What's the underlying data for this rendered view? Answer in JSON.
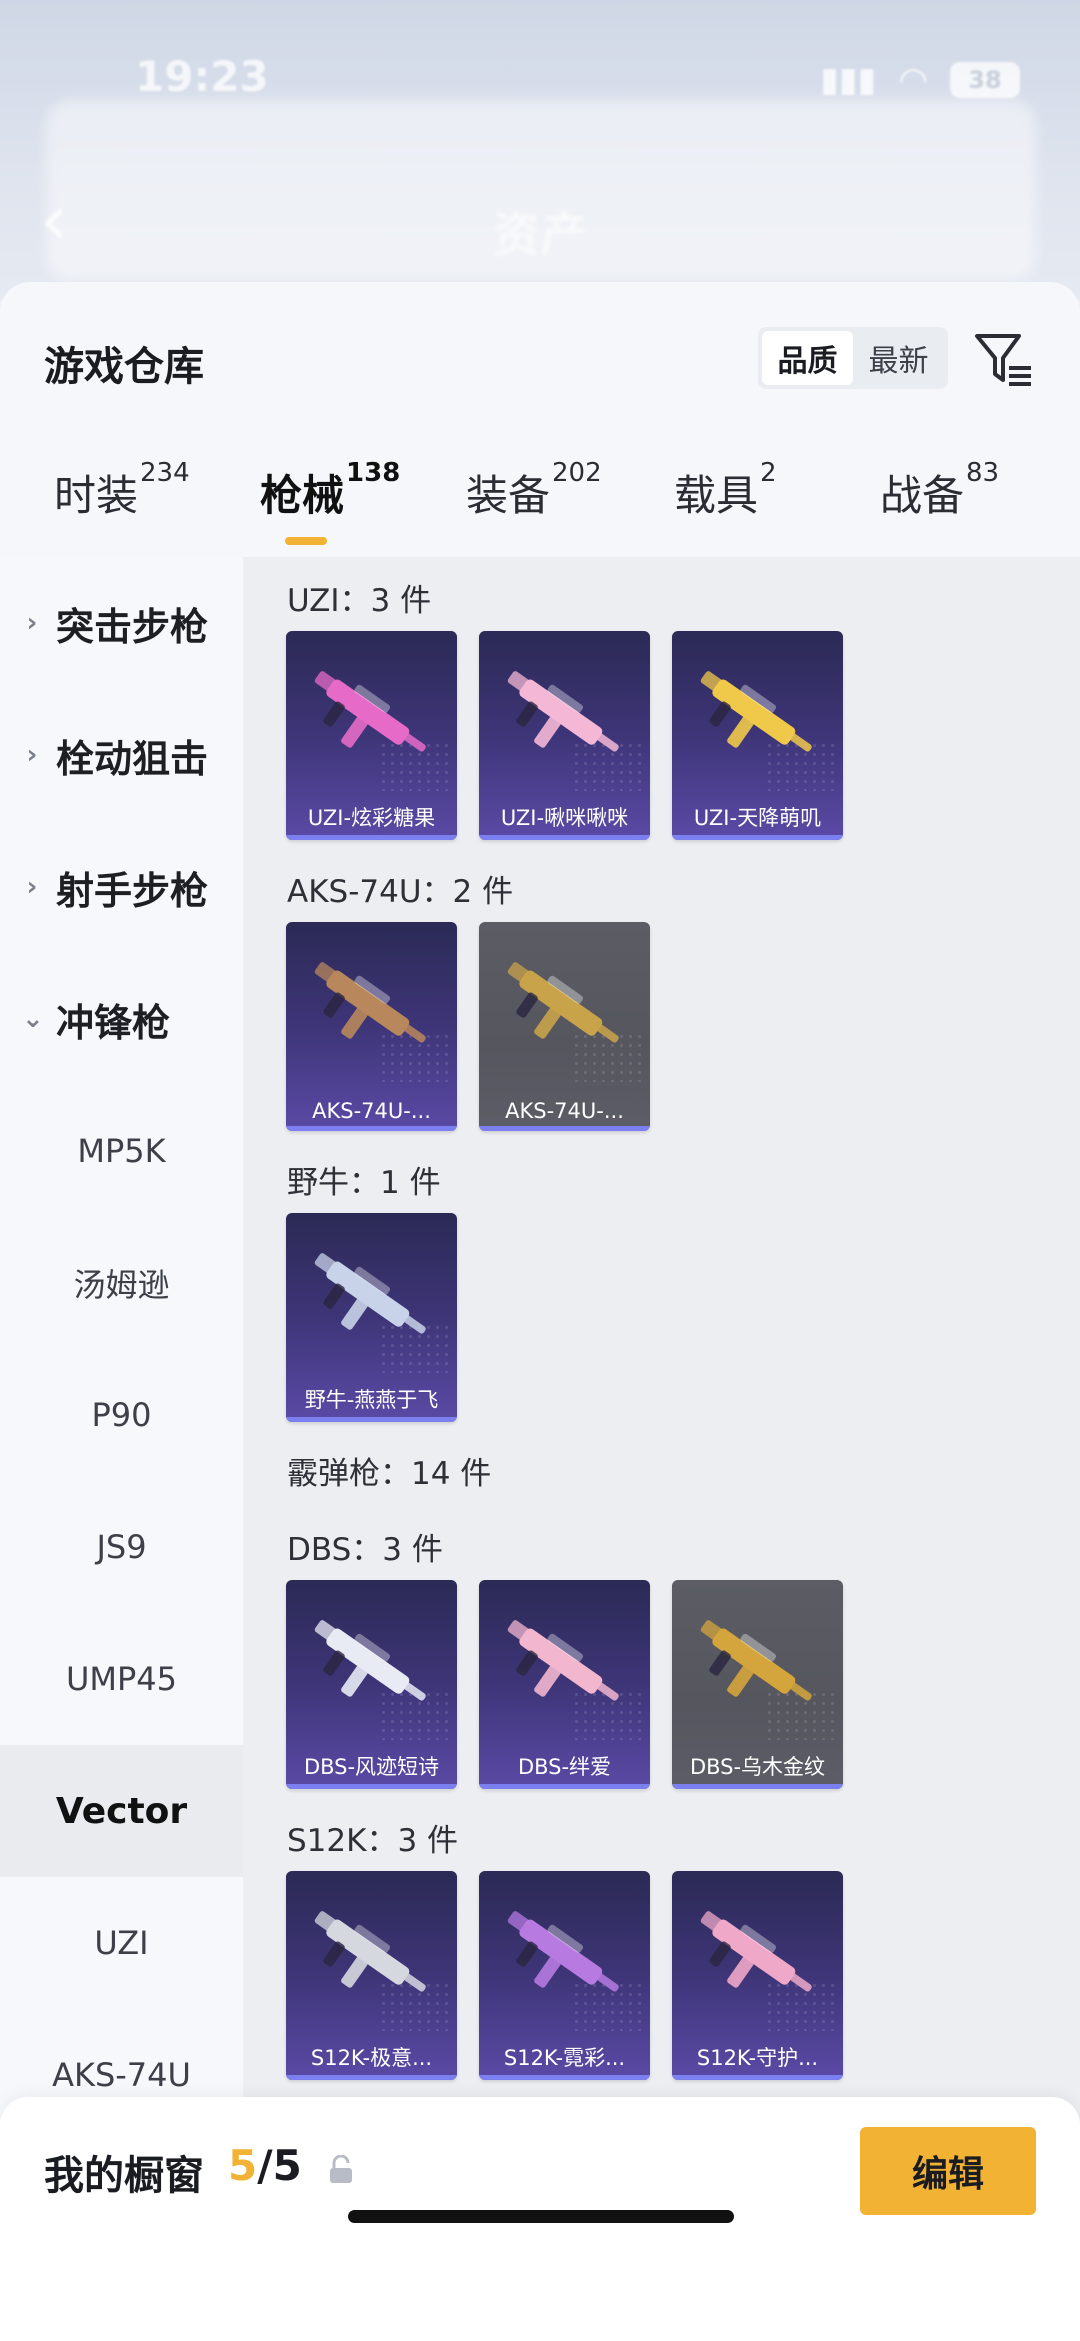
{
  "status_bar": {
    "time": "19:23",
    "battery": "38"
  },
  "header": {
    "title": "资产"
  },
  "sheet": {
    "title": "游戏仓库",
    "sort_options": [
      "品质",
      "最新"
    ],
    "active_sort": "品质"
  },
  "tabs": [
    {
      "label": "时装",
      "count": "234"
    },
    {
      "label": "枪械",
      "count": "138"
    },
    {
      "label": "装备",
      "count": "202"
    },
    {
      "label": "载具",
      "count": "2"
    },
    {
      "label": "战备",
      "count": "83"
    }
  ],
  "active_tab": "枪械",
  "sidebar": {
    "groups": [
      {
        "label": "突击步枪",
        "chevron": "chevron-right-icon"
      },
      {
        "label": "栓动狙击",
        "chevron": "chevron-right-icon"
      },
      {
        "label": "射手步枪",
        "chevron": "chevron-right-icon"
      },
      {
        "label": "冲锋枪",
        "chevron": "chevron-down-icon"
      }
    ],
    "sub_items": [
      "MP5K",
      "汤姆逊",
      "P90",
      "JS9",
      "UMP45",
      "Vector",
      "UZI",
      "AKS-74U"
    ],
    "active_item": "Vector"
  },
  "sections": [
    {
      "title": "UZI：3 件",
      "items": [
        {
          "name": "UZI-炫彩糖果",
          "style": "purple",
          "color": "#e66bc8"
        },
        {
          "name": "UZI-啾咪啾咪",
          "style": "purple",
          "color": "#f4b8d6"
        },
        {
          "name": "UZI-天降萌叽",
          "style": "purple",
          "color": "#f1c94a"
        }
      ]
    },
    {
      "title": "AKS-74U：2 件",
      "items": [
        {
          "name": "AKS-74U-...",
          "style": "purple",
          "color": "#b8875c"
        },
        {
          "name": "AKS-74U-...",
          "style": "grey",
          "color": "#c9a34a"
        }
      ]
    },
    {
      "title": "野牛：1 件",
      "items": [
        {
          "name": "野牛-燕燕于飞",
          "style": "purple",
          "color": "#c8d2e8"
        }
      ]
    },
    {
      "title": "霰弹枪：14 件",
      "items": []
    },
    {
      "title": "DBS：3 件",
      "items": [
        {
          "name": "DBS-风迹短诗",
          "style": "purple",
          "color": "#e8eaf4"
        },
        {
          "name": "DBS-绊爱",
          "style": "purple",
          "color": "#f2b6cf"
        },
        {
          "name": "DBS-乌木金纹",
          "style": "grey",
          "color": "#d4a53c"
        }
      ]
    },
    {
      "title": "S12K：3 件",
      "items": [
        {
          "name": "S12K-极意...",
          "style": "purple",
          "color": "#d6d8e0"
        },
        {
          "name": "S12K-霓彩...",
          "style": "purple",
          "color": "#b67ae0"
        },
        {
          "name": "S12K-守护...",
          "style": "purple",
          "color": "#f0a8c8"
        }
      ]
    }
  ],
  "bottom": {
    "label": "我的橱窗",
    "current": "5",
    "total": "/5",
    "edit_label": "编辑"
  },
  "colors": {
    "accent": "#f2b233",
    "card_purple": "#3e3578",
    "card_grey": "#56575f"
  }
}
